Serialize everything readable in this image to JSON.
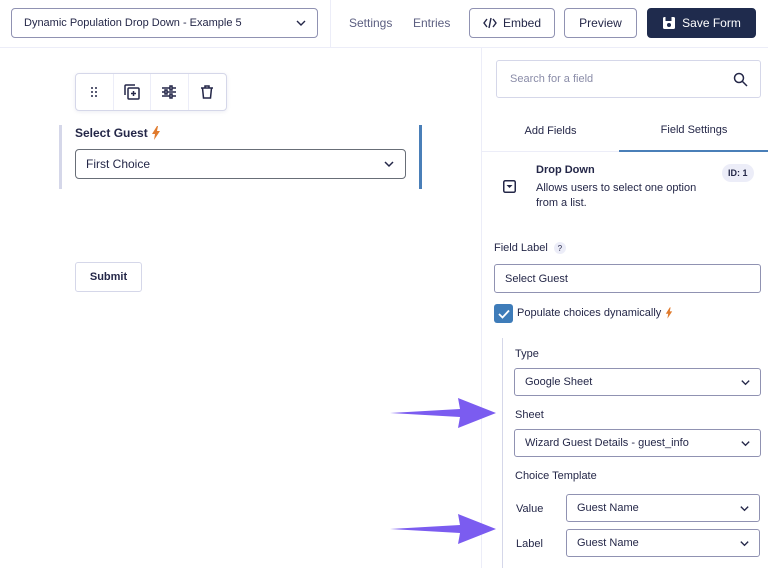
{
  "header": {
    "form_name": "Dynamic Population Drop Down - Example 5",
    "settings_label": "Settings",
    "entries_label": "Entries",
    "embed_label": "Embed",
    "preview_label": "Preview",
    "save_label": "Save Form"
  },
  "canvas": {
    "field_label": "Select Guest",
    "field_value": "First Choice",
    "submit_label": "Submit"
  },
  "sidebar": {
    "search_placeholder": "Search for a field",
    "tabs": [
      {
        "label": "Add Fields",
        "active": false
      },
      {
        "label": "Field Settings",
        "active": true
      }
    ],
    "field_type": "Drop Down",
    "field_desc": "Allows users to select one option from a list.",
    "id_badge": "ID: 1",
    "field_label_title": "Field Label",
    "help_glyph": "?",
    "field_label_value": "Select Guest",
    "populate_label": "Populate choices dynamically",
    "populate_checked": true,
    "type_title": "Type",
    "type_value": "Google Sheet",
    "sheet_title": "Sheet",
    "sheet_value": "Wizard Guest Details - guest_info",
    "choice_template_title": "Choice Template",
    "value_title": "Value",
    "value_value": "Guest Name",
    "label_title": "Label",
    "label_value": "Guest Name"
  },
  "colors": {
    "primary": "#1f2b4d",
    "accent_blue": "#3e7cb9",
    "bolt_orange": "#e07a2c",
    "annotation_arrow": "#7b5cf0"
  }
}
